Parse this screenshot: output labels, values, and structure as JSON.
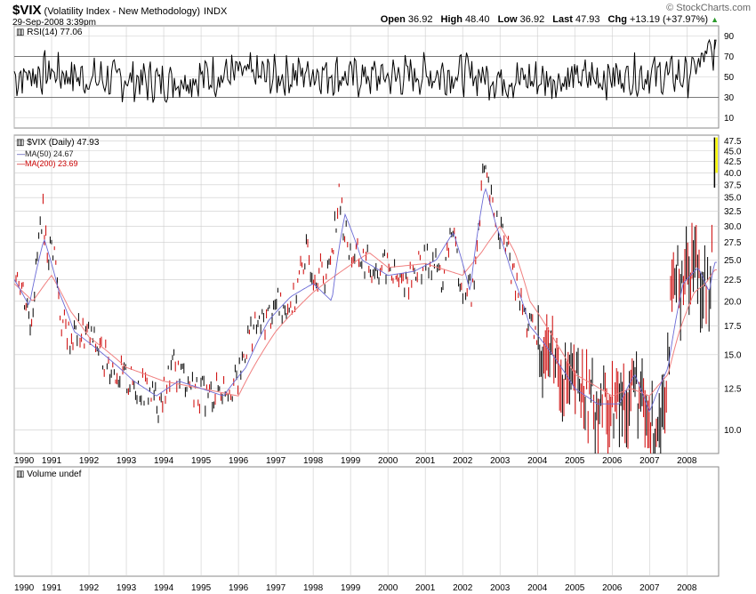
{
  "header": {
    "symbol": "$VIX",
    "name": "(Volatility Index - New Methodology)",
    "exchange": "INDX",
    "datetime": "29-Sep-2008 3:39pm",
    "logo": "© StockCharts.com",
    "stats": {
      "open_label": "Open",
      "open": "36.92",
      "high_label": "High",
      "high": "48.40",
      "low_label": "Low",
      "low": "36.92",
      "last_label": "Last",
      "last": "47.93",
      "chg_label": "Chg",
      "chg": "+13.19 (+37.97%)"
    }
  },
  "colors": {
    "price": "#000000",
    "price_down": "#cc0000",
    "ma50": "#6b6bd6",
    "ma200": "#f08080",
    "grid": "#cccccc",
    "frame": "#888888",
    "highlight": "#ffff00"
  },
  "rsi_panel": {
    "legend": "RSI(14) 77.06",
    "ticks": [
      "90",
      "70",
      "50",
      "30",
      "10"
    ]
  },
  "price_panel": {
    "legend_main": "$VIX (Daily) 47.93",
    "legend_ma50": "MA(50) 24.67",
    "legend_ma200": "MA(200) 23.69"
  },
  "volume_panel": {
    "legend": "Volume undef"
  },
  "x_ticks": [
    "1990",
    "1991",
    "1992",
    "1993",
    "1994",
    "1995",
    "1996",
    "1997",
    "1998",
    "1999",
    "2000",
    "2001",
    "2002",
    "2003",
    "2004",
    "2005",
    "2006",
    "2007",
    "2008"
  ],
  "chart_data": [
    {
      "type": "line",
      "title": "RSI(14) 77.06",
      "ylim": [
        0,
        100
      ],
      "y_ticks": [
        90,
        70,
        50,
        30,
        10
      ],
      "reference_lines": [
        70,
        30
      ],
      "series": [
        {
          "name": "RSI(14)",
          "x": [
            1990.0,
            1991.0,
            1992.0,
            1993.0,
            1994.0,
            1995.0,
            1996.0,
            1997.0,
            1998.0,
            1999.0,
            2000.0,
            2001.0,
            2002.0,
            2003.0,
            2004.0,
            2005.0,
            2006.0,
            2007.0,
            2008.0,
            2008.74
          ],
          "values": [
            50,
            55,
            48,
            47,
            45,
            50,
            53,
            50,
            55,
            50,
            50,
            52,
            53,
            48,
            47,
            48,
            50,
            52,
            51,
            77.06
          ]
        }
      ]
    },
    {
      "type": "line",
      "title": "$VIX (Daily) 47.93",
      "y_scale": "log",
      "ylim": [
        8.8,
        49
      ],
      "y_ticks": [
        10.0,
        12.5,
        15.0,
        17.5,
        20.0,
        22.5,
        25.0,
        27.5,
        30.0,
        32.5,
        35.0,
        37.5,
        40.0,
        42.5,
        45.0,
        47.5
      ],
      "x_ticks": [
        "1990",
        "1991",
        "1992",
        "1993",
        "1994",
        "1995",
        "1996",
        "1997",
        "1998",
        "1999",
        "2000",
        "2001",
        "2002",
        "2003",
        "2004",
        "2005",
        "2006",
        "2007",
        "2008"
      ],
      "series": [
        {
          "name": "$VIX",
          "x": [
            1990.0,
            1990.25,
            1990.45,
            1990.6,
            1990.75,
            1990.9,
            1991.05,
            1991.25,
            1991.5,
            1991.75,
            1992.0,
            1992.5,
            1993.0,
            1993.5,
            1993.9,
            1994.25,
            1994.5,
            1994.8,
            1995.2,
            1995.5,
            1996.0,
            1996.3,
            1996.6,
            1997.0,
            1997.5,
            1997.8,
            1998.0,
            1998.4,
            1998.7,
            1998.85,
            1999.0,
            1999.3,
            1999.6,
            2000.0,
            2000.3,
            2000.6,
            2000.9,
            2001.2,
            2001.5,
            2001.7,
            2001.8,
            2002.0,
            2002.3,
            2002.55,
            2002.8,
            2003.0,
            2003.2,
            2003.4,
            2003.7,
            2004.0,
            2004.4,
            2004.8,
            2005.2,
            2005.6,
            2006.0,
            2006.4,
            2006.6,
            2006.9,
            2007.15,
            2007.4,
            2007.6,
            2007.8,
            2008.0,
            2008.2,
            2008.5,
            2008.65,
            2008.74
          ],
          "values": [
            25.0,
            21.0,
            18.0,
            24.0,
            33.0,
            26.0,
            27.0,
            18.0,
            16.5,
            17.0,
            16.5,
            14.5,
            13.0,
            12.5,
            11.5,
            14.0,
            13.5,
            12.5,
            12.0,
            12.5,
            13.0,
            17.0,
            17.5,
            19.5,
            20.0,
            26.0,
            24.0,
            23.0,
            35.0,
            29.0,
            26.0,
            25.0,
            24.0,
            24.0,
            22.0,
            23.0,
            24.5,
            25.0,
            22.0,
            30.0,
            26.0,
            22.0,
            21.0,
            40.0,
            33.0,
            30.0,
            26.0,
            22.0,
            18.0,
            16.0,
            15.0,
            13.0,
            12.5,
            11.5,
            11.5,
            12.0,
            13.0,
            10.5,
            10.0,
            12.0,
            20.0,
            23.0,
            24.0,
            26.0,
            22.0,
            19.5,
            47.93
          ]
        },
        {
          "name": "MA(50)",
          "x": [
            1990.0,
            1990.4,
            1990.8,
            1991.2,
            1991.6,
            1992.0,
            1992.6,
            1993.2,
            1993.8,
            1994.4,
            1995.0,
            1995.6,
            1996.2,
            1996.8,
            1997.4,
            1998.0,
            1998.5,
            1998.85,
            1999.3,
            2000.0,
            2000.7,
            2001.3,
            2001.75,
            2002.2,
            2002.6,
            2002.9,
            2003.3,
            2003.8,
            2004.4,
            2005.0,
            2005.6,
            2006.2,
            2006.6,
            2007.0,
            2007.5,
            2007.9,
            2008.3,
            2008.6,
            2008.74
          ],
          "values": [
            22.5,
            19.5,
            28.0,
            21.0,
            17.0,
            16.0,
            14.5,
            13.0,
            12.0,
            13.0,
            12.5,
            12.0,
            14.0,
            18.0,
            20.5,
            22.0,
            20.0,
            32.0,
            25.0,
            23.0,
            23.5,
            25.0,
            29.0,
            21.0,
            37.0,
            30.0,
            23.5,
            17.5,
            15.0,
            12.5,
            11.5,
            11.5,
            13.5,
            11.0,
            14.0,
            22.0,
            24.0,
            21.0,
            24.67
          ]
        },
        {
          "name": "MA(200)",
          "x": [
            1990.0,
            1990.5,
            1991.0,
            1991.5,
            1992.0,
            1993.0,
            1994.0,
            1995.0,
            1996.0,
            1997.0,
            1998.0,
            1998.9,
            1999.5,
            2000.0,
            2001.0,
            2002.0,
            2002.5,
            2003.0,
            2003.4,
            2003.8,
            2004.5,
            2005.0,
            2006.0,
            2006.5,
            2007.0,
            2007.5,
            2007.8,
            2008.2,
            2008.5,
            2008.74
          ],
          "values": [
            22.0,
            20.0,
            23.0,
            19.0,
            16.5,
            14.0,
            13.0,
            12.5,
            12.0,
            17.0,
            21.0,
            24.0,
            26.0,
            24.0,
            24.5,
            23.0,
            26.0,
            30.0,
            26.0,
            20.0,
            16.0,
            13.5,
            12.0,
            12.5,
            12.0,
            13.5,
            17.0,
            21.0,
            22.0,
            23.69
          ]
        }
      ]
    }
  ]
}
